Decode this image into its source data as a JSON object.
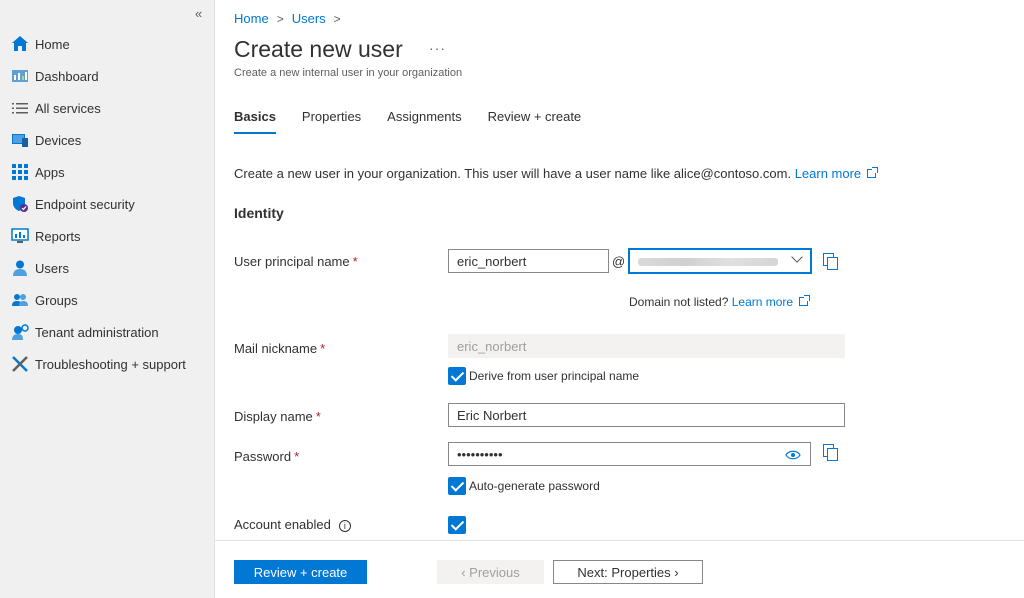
{
  "sidebar": {
    "collapse_glyph": "«",
    "items": [
      {
        "label": "Home",
        "icon": "home-icon"
      },
      {
        "label": "Dashboard",
        "icon": "dashboard-icon"
      },
      {
        "label": "All services",
        "icon": "list-icon"
      },
      {
        "label": "Devices",
        "icon": "devices-icon"
      },
      {
        "label": "Apps",
        "icon": "apps-icon"
      },
      {
        "label": "Endpoint security",
        "icon": "shield-icon"
      },
      {
        "label": "Reports",
        "icon": "reports-icon"
      },
      {
        "label": "Users",
        "icon": "user-icon"
      },
      {
        "label": "Groups",
        "icon": "groups-icon"
      },
      {
        "label": "Tenant administration",
        "icon": "tenant-admin-icon"
      },
      {
        "label": "Troubleshooting + support",
        "icon": "wrench-icon"
      }
    ]
  },
  "breadcrumb": {
    "home": "Home",
    "users": "Users",
    "sep": ">"
  },
  "header": {
    "title": "Create new user",
    "more": "···",
    "subtitle": "Create a new internal user in your organization"
  },
  "tabs": [
    {
      "label": "Basics",
      "active": true
    },
    {
      "label": "Properties",
      "active": false
    },
    {
      "label": "Assignments",
      "active": false
    },
    {
      "label": "Review + create",
      "active": false
    }
  ],
  "intro": {
    "text": "Create a new user in your organization. This user will have a user name like alice@contoso.com.",
    "link": "Learn more"
  },
  "identity": {
    "section_title": "Identity",
    "upn_label": "User principal name",
    "upn_value": "eric_norbert",
    "at": "@",
    "domain_note": "Domain not listed?",
    "domain_link": "Learn more",
    "mail_label": "Mail nickname",
    "mail_value": "eric_norbert",
    "derive_label": "Derive from user principal name",
    "display_label": "Display name",
    "display_value": "Eric Norbert",
    "password_label": "Password",
    "password_value": "••••••••••",
    "autogen_label": "Auto-generate password",
    "account_label": "Account enabled",
    "info_glyph": "i",
    "required": "*"
  },
  "footer": {
    "review_label": "Review + create",
    "previous_label": "‹  Previous",
    "next_label": "Next: Properties  ›"
  },
  "colors": {
    "accent": "#0078d4",
    "required": "#a4262c"
  }
}
